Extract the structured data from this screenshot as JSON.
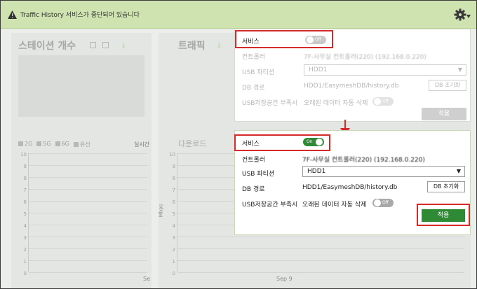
{
  "topbar": {
    "message": "Traffic History 서비스가 중단되어 있습니다",
    "settings_icon": "gear-icon",
    "warning_icon": "warning-icon"
  },
  "dashboard": {
    "station_count_title": "스테이션 개수",
    "traffic_title": "트래픽",
    "bands": [
      "2G",
      "5G",
      "6G",
      "유선"
    ],
    "realtime_label": "실시간",
    "download_label": "다운로드",
    "y_ticks": [
      "10",
      "9",
      "8",
      "7",
      "6",
      "5",
      "4",
      "3",
      "2",
      "1",
      "0"
    ],
    "y_unit": "Mbps",
    "x_label_left": "Se",
    "x_label_right": "Sep 9"
  },
  "settings_before": {
    "service_label": "서비스",
    "service_state": "Off",
    "controller_label": "컨트롤러",
    "controller_value": "7F-사무실 컨트롤러(220) (192.168.0.220)",
    "usb_partition_label": "USB 파티션",
    "usb_partition_value": "HDD1",
    "db_path_label": "DB 경로",
    "db_path_value": "HDD1/EasymeshDB/history.db",
    "db_reset_button": "DB 초기화",
    "usb_full_label": "USB저장공간 부족시",
    "usb_full_value": "오래된 데이터 자동 삭제",
    "usb_full_state": "Off",
    "apply_button": "적용"
  },
  "settings_after": {
    "service_label": "서비스",
    "service_state": "On",
    "controller_label": "컨트롤러",
    "controller_value": "7F-사무실 컨트롤러(220) (192.168.0.220)",
    "usb_partition_label": "USB 파티션",
    "usb_partition_value": "HDD1",
    "db_path_label": "DB 경로",
    "db_path_value": "HDD1/EasymeshDB/history.db",
    "db_reset_button": "DB 초기화",
    "usb_full_label": "USB저장공간 부족시",
    "usb_full_value": "오래된 데이터 자동 삭제",
    "usb_full_state": "Off",
    "apply_button": "적용"
  },
  "colors": {
    "topbar_bg": "#cfe3b0",
    "accent_green": "#2f8a36",
    "highlight_red": "#d42a2a"
  }
}
